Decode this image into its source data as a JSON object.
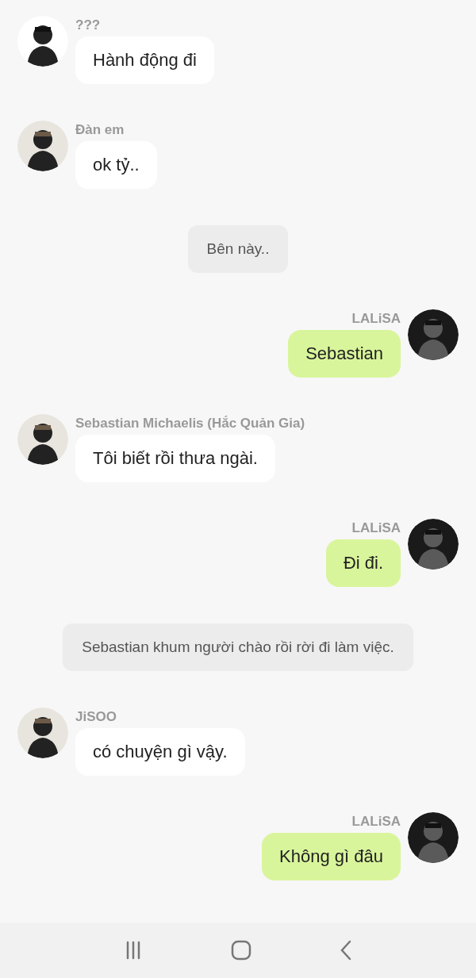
{
  "messages": [
    {
      "kind": "incoming",
      "sender": "???",
      "text": "Hành động đi"
    },
    {
      "kind": "incoming",
      "sender": "Đàn em",
      "text": "ok tỷ.."
    },
    {
      "kind": "narration",
      "text": "Bên này.."
    },
    {
      "kind": "outgoing",
      "sender": "LALiSA",
      "text": "Sebastian"
    },
    {
      "kind": "incoming",
      "sender": "Sebastian Michaelis (Hắc Quản Gia)",
      "text": "Tôi biết rồi thưa ngài."
    },
    {
      "kind": "outgoing",
      "sender": "LALiSA",
      "text": "Đi đi."
    },
    {
      "kind": "narration",
      "text": "Sebastian khum người chào rồi rời đi làm việc."
    },
    {
      "kind": "incoming",
      "sender": "JiSOO",
      "text": "có chuyện gì vậy."
    },
    {
      "kind": "outgoing",
      "sender": "LALiSA",
      "text": "Không gì đâu"
    }
  ]
}
